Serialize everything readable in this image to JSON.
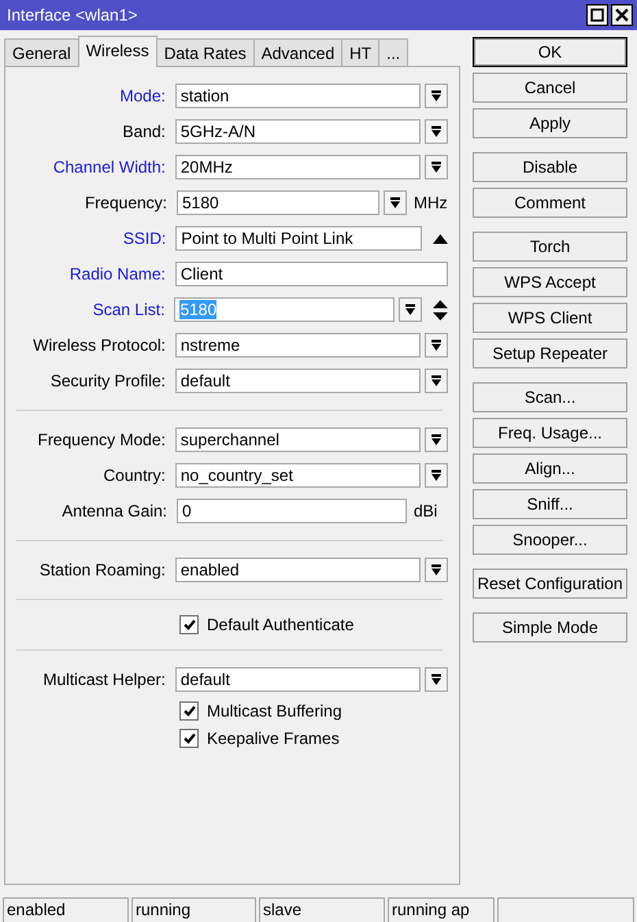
{
  "window": {
    "title": "Interface <wlan1>"
  },
  "tabs": [
    {
      "label": "General",
      "selected": false
    },
    {
      "label": "Wireless",
      "selected": true
    },
    {
      "label": "Data Rates",
      "selected": false
    },
    {
      "label": "Advanced",
      "selected": false
    },
    {
      "label": "HT",
      "selected": false
    },
    {
      "label": "...",
      "selected": false
    }
  ],
  "fields": [
    {
      "kind": "dropdown",
      "label": "Mode:",
      "emphasized": true,
      "value": "station"
    },
    {
      "kind": "dropdown",
      "label": "Band:",
      "emphasized": false,
      "value": "5GHz-A/N"
    },
    {
      "kind": "dropdown",
      "label": "Channel Width:",
      "emphasized": true,
      "value": "20MHz"
    },
    {
      "kind": "dropdown",
      "label": "Frequency:",
      "emphasized": false,
      "value": "5180",
      "unit": "MHz"
    },
    {
      "kind": "text",
      "label": "SSID:",
      "emphasized": true,
      "value": "Point to Multi Point Link",
      "collapsible": true
    },
    {
      "kind": "text",
      "label": "Radio Name:",
      "emphasized": true,
      "value": "Client"
    },
    {
      "kind": "dropdown",
      "label": "Scan List:",
      "emphasized": true,
      "value": "5180",
      "highlighted": true,
      "spinner": true
    },
    {
      "kind": "dropdown",
      "label": "Wireless Protocol:",
      "emphasized": false,
      "value": "nstreme"
    },
    {
      "kind": "dropdown",
      "label": "Security Profile:",
      "emphasized": false,
      "value": "default"
    },
    {
      "kind": "separator"
    },
    {
      "kind": "dropdown",
      "label": "Frequency Mode:",
      "emphasized": false,
      "value": "superchannel"
    },
    {
      "kind": "dropdown",
      "label": "Country:",
      "emphasized": false,
      "value": "no_country_set"
    },
    {
      "kind": "text",
      "label": "Antenna Gain:",
      "emphasized": false,
      "value": "0",
      "unit": "dBi"
    },
    {
      "kind": "separator"
    },
    {
      "kind": "dropdown",
      "label": "Station Roaming:",
      "emphasized": false,
      "value": "enabled"
    },
    {
      "kind": "separator"
    },
    {
      "kind": "checkbox",
      "label": "Default Authenticate",
      "checked": true
    },
    {
      "kind": "separator"
    },
    {
      "kind": "dropdown",
      "label": "Multicast Helper:",
      "emphasized": false,
      "value": "default"
    },
    {
      "kind": "checkbox",
      "label": "Multicast Buffering",
      "checked": true
    },
    {
      "kind": "checkbox",
      "label": "Keepalive Frames",
      "checked": true
    }
  ],
  "button_groups": [
    [
      {
        "label": "OK",
        "default": true
      },
      {
        "label": "Cancel",
        "default": false
      },
      {
        "label": "Apply",
        "default": false
      }
    ],
    [
      {
        "label": "Disable",
        "default": false
      },
      {
        "label": "Comment",
        "default": false
      }
    ],
    [
      {
        "label": "Torch",
        "default": false
      },
      {
        "label": "WPS Accept",
        "default": false
      },
      {
        "label": "WPS Client",
        "default": false
      },
      {
        "label": "Setup Repeater",
        "default": false
      }
    ],
    [
      {
        "label": "Scan...",
        "default": false
      },
      {
        "label": "Freq. Usage...",
        "default": false
      },
      {
        "label": "Align...",
        "default": false
      },
      {
        "label": "Sniff...",
        "default": false
      },
      {
        "label": "Snooper...",
        "default": false
      }
    ],
    [
      {
        "label": "Reset Configuration",
        "default": false
      }
    ],
    [
      {
        "label": "Simple Mode",
        "default": false
      }
    ]
  ],
  "status_bar": [
    "enabled",
    "running",
    "slave",
    "running ap"
  ]
}
